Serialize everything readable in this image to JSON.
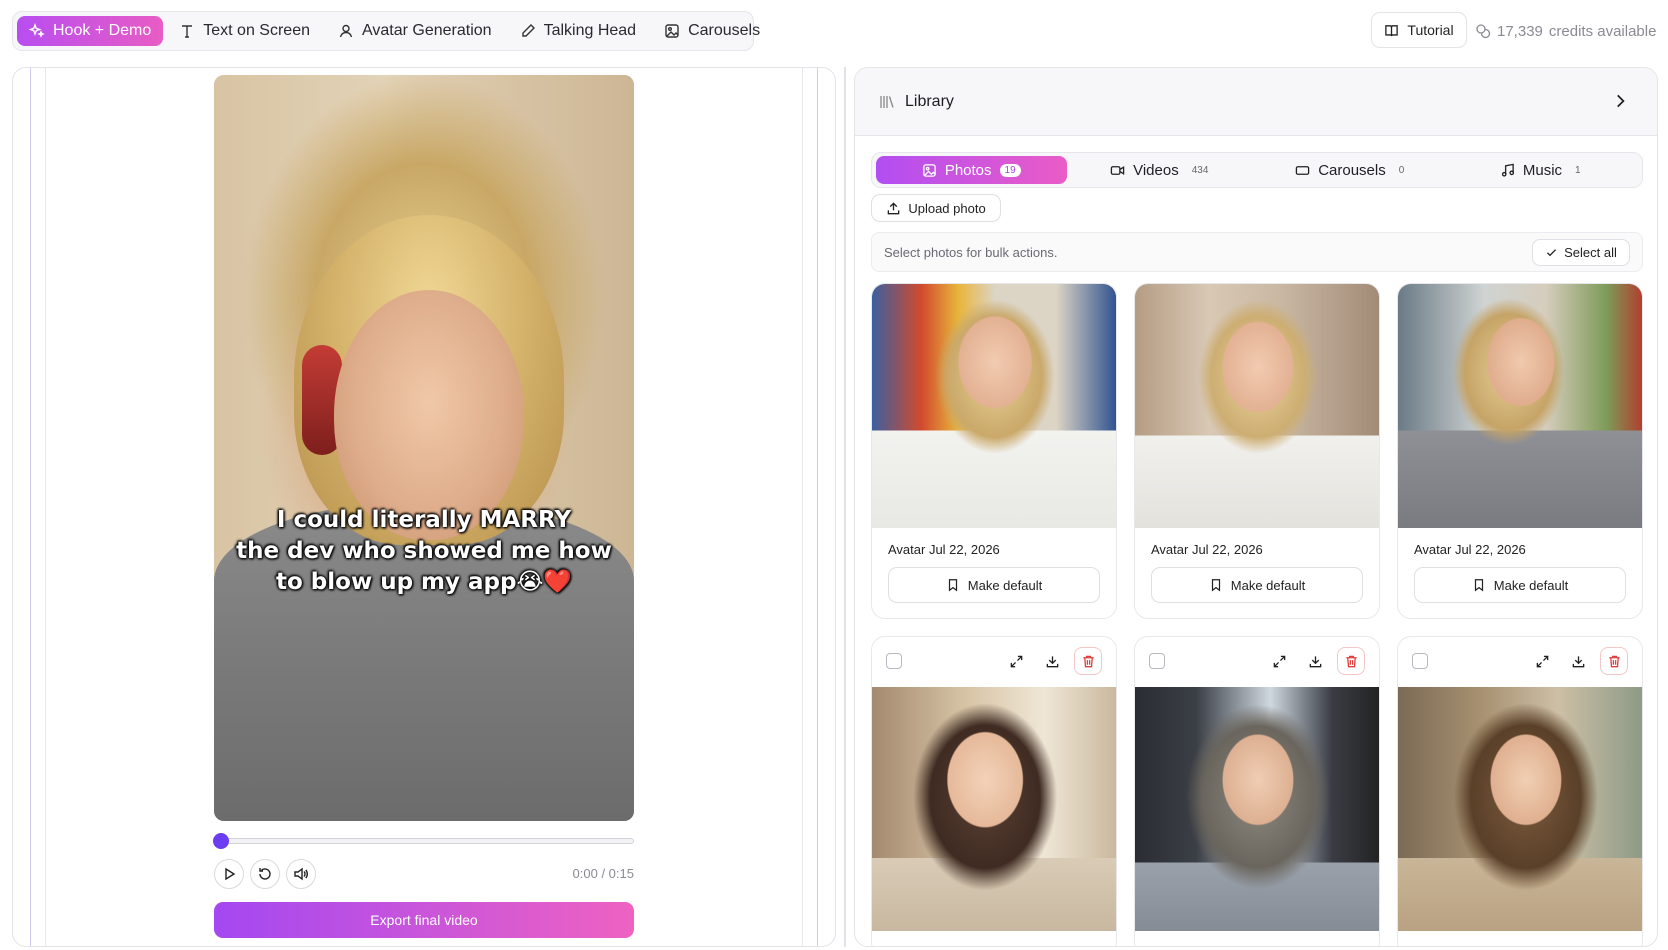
{
  "topnav": {
    "tabs": [
      {
        "label": "Hook + Demo",
        "icon": "sparkles-icon"
      },
      {
        "label": "Text on Screen",
        "icon": "text-icon"
      },
      {
        "label": "Avatar Generation",
        "icon": "user-icon"
      },
      {
        "label": "Talking Head",
        "icon": "pen-icon"
      },
      {
        "label": "Carousels",
        "icon": "images-icon"
      }
    ],
    "active_index": 0
  },
  "tutorial": {
    "label": "Tutorial"
  },
  "credits": {
    "count": "17,339",
    "label": "credits available"
  },
  "player": {
    "caption_lines": [
      "I could literally MARRY",
      "the dev who showed me how",
      "to blow up my app😭❤️"
    ],
    "time": "0:00 / 0:15",
    "progress": 0.0,
    "export_label": "Export final video"
  },
  "library": {
    "title": "Library",
    "tabs": [
      {
        "label": "Photos",
        "count": "19"
      },
      {
        "label": "Videos",
        "count": "434"
      },
      {
        "label": "Carousels",
        "count": "0"
      },
      {
        "label": "Music",
        "count": "1"
      }
    ],
    "upload_label": "Upload photo",
    "bulk_text": "Select photos for bulk actions.",
    "select_all_label": "Select all",
    "photos": [
      {
        "caption": "Avatar Jul 22, 2026",
        "action": "Make default"
      },
      {
        "caption": "Avatar Jul 22, 2026",
        "action": "Make default"
      },
      {
        "caption": "Avatar Jul 22, 2026",
        "action": "Make default"
      }
    ]
  },
  "colors": {
    "accent_start": "#b24ef2",
    "accent_end": "#ea5cc6",
    "knob": "#6c3cf0"
  }
}
